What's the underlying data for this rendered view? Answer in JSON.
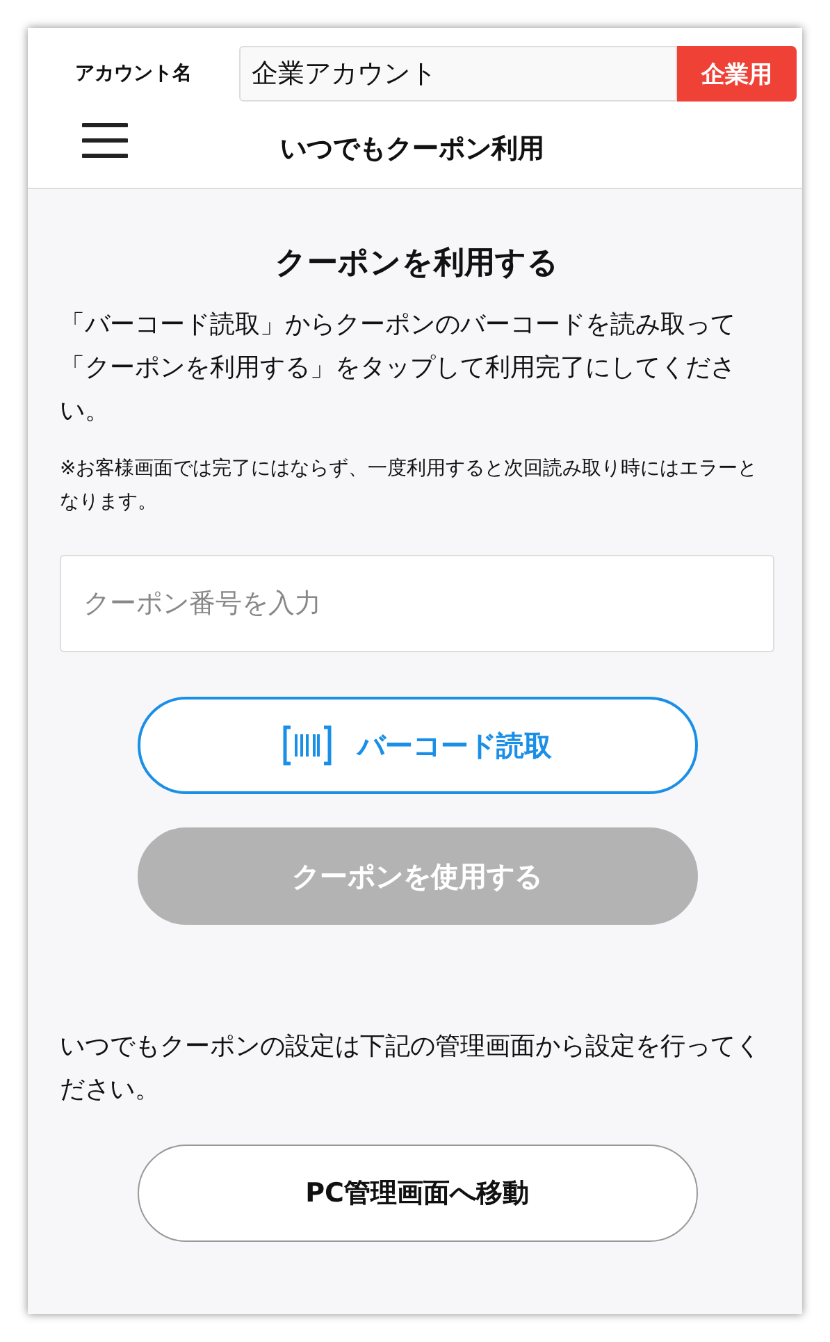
{
  "header": {
    "account_label": "アカウント名",
    "account_value": "企業アカウント",
    "account_badge": "企業用",
    "title": "いつでもクーポン利用"
  },
  "main": {
    "heading": "クーポンを利用する",
    "description": "「バーコード読取」からクーポンのバーコードを読み取って「クーポンを利用する」をタップして利用完了にしてください。",
    "note": "※お客様画面では完了にはならず、一度利用すると次回読み取り時にはエラーとなります。",
    "coupon_field": {
      "placeholder": "クーポン番号を入力"
    },
    "buttons": [
      {
        "kind": "scan",
        "label": "バーコード読取",
        "disabled": false
      },
      {
        "kind": "use",
        "label": "クーポンを使用する",
        "disabled": true
      }
    ]
  },
  "settings": {
    "text": "いつでもクーポンの設定は下記の管理画面から設定を行ってください。",
    "button": "PC管理画面へ移動"
  }
}
